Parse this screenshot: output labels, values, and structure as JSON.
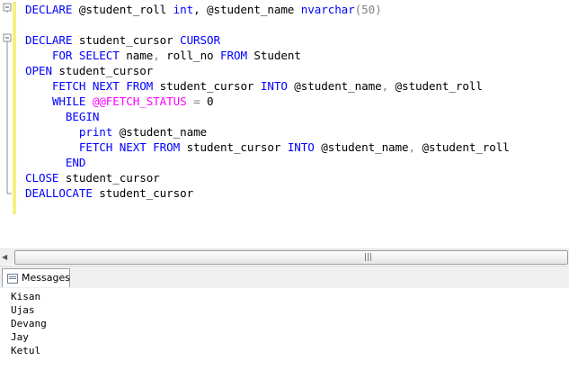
{
  "editor": {
    "lines": [
      [
        {
          "t": "DECLARE",
          "c": "kw"
        },
        {
          "t": " @student_roll ",
          "c": ""
        },
        {
          "t": "int",
          "c": "kw"
        },
        {
          "t": ", @student_name ",
          "c": ""
        },
        {
          "t": "nvarchar",
          "c": "kw"
        },
        {
          "t": "(50)",
          "c": "gr"
        }
      ],
      [],
      [
        {
          "t": "DECLARE",
          "c": "kw"
        },
        {
          "t": " student_cursor ",
          "c": ""
        },
        {
          "t": "CURSOR",
          "c": "kw"
        }
      ],
      [
        {
          "t": "    ",
          "c": ""
        },
        {
          "t": "FOR SELECT",
          "c": "kw"
        },
        {
          "t": " name",
          "c": ""
        },
        {
          "t": ",",
          "c": "gr"
        },
        {
          "t": " roll_no ",
          "c": ""
        },
        {
          "t": "FROM",
          "c": "kw"
        },
        {
          "t": " Student",
          "c": ""
        }
      ],
      [
        {
          "t": "OPEN",
          "c": "kw"
        },
        {
          "t": " student_cursor",
          "c": ""
        }
      ],
      [
        {
          "t": "    ",
          "c": ""
        },
        {
          "t": "FETCH NEXT FROM",
          "c": "kw"
        },
        {
          "t": " student_cursor ",
          "c": ""
        },
        {
          "t": "INTO",
          "c": "kw"
        },
        {
          "t": " @student_name",
          "c": ""
        },
        {
          "t": ",",
          "c": "gr"
        },
        {
          "t": " @student_roll",
          "c": ""
        }
      ],
      [
        {
          "t": "    ",
          "c": ""
        },
        {
          "t": "WHILE",
          "c": "kw"
        },
        {
          "t": " ",
          "c": ""
        },
        {
          "t": "@@FETCH_STATUS",
          "c": "fn"
        },
        {
          "t": " = ",
          "c": "gr"
        },
        {
          "t": "0",
          "c": ""
        }
      ],
      [
        {
          "t": "      ",
          "c": ""
        },
        {
          "t": "BEGIN",
          "c": "kw"
        }
      ],
      [
        {
          "t": "        ",
          "c": ""
        },
        {
          "t": "print",
          "c": "kw"
        },
        {
          "t": " @student_name",
          "c": ""
        }
      ],
      [
        {
          "t": "        ",
          "c": ""
        },
        {
          "t": "FETCH NEXT FROM",
          "c": "kw"
        },
        {
          "t": " student_cursor ",
          "c": ""
        },
        {
          "t": "INTO",
          "c": "kw"
        },
        {
          "t": " @student_name",
          "c": ""
        },
        {
          "t": ",",
          "c": "gr"
        },
        {
          "t": " @student_roll",
          "c": ""
        }
      ],
      [
        {
          "t": "      ",
          "c": ""
        },
        {
          "t": "END",
          "c": "kw"
        }
      ],
      [
        {
          "t": "CLOSE",
          "c": "kw"
        },
        {
          "t": " student_cursor",
          "c": ""
        }
      ],
      [
        {
          "t": "DEALLOCATE",
          "c": "kw"
        },
        {
          "t": " student_cursor",
          "c": ""
        }
      ]
    ]
  },
  "results": {
    "tab_label": "Messages",
    "messages": [
      "Kisan",
      "Ujas",
      "Devang",
      "Jay",
      "Ketul"
    ]
  },
  "colors": {
    "keyword": "#0000ff",
    "system_function": "#ff00ff",
    "operator": "#808080",
    "change_bar": "#f6f080"
  }
}
